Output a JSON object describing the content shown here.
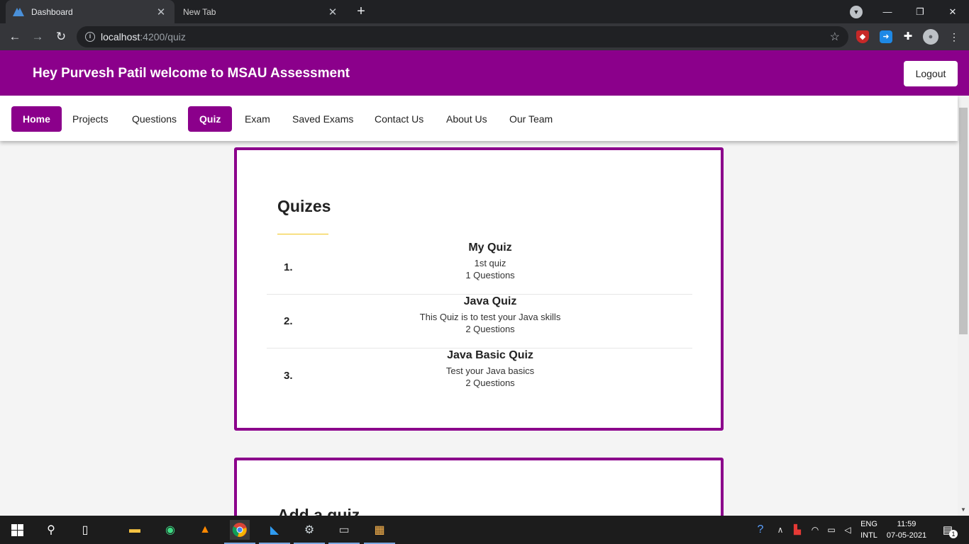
{
  "browser": {
    "tabs": [
      {
        "title": "Dashboard",
        "active": true
      },
      {
        "title": "New Tab",
        "active": false
      }
    ],
    "new_tab_glyph": "+",
    "url_host": "localhost",
    "url_path": ":4200/quiz"
  },
  "app": {
    "header_title": "Hey Purvesh Patil welcome to MSAU Assessment",
    "logout_label": "Logout",
    "accent_color": "#8b008b",
    "nav": [
      {
        "label": "Home",
        "active": true
      },
      {
        "label": "Projects",
        "active": false
      },
      {
        "label": "Questions",
        "active": false
      },
      {
        "label": "Quiz",
        "active": true
      },
      {
        "label": "Exam",
        "active": false
      },
      {
        "label": "Saved Exams",
        "active": false
      },
      {
        "label": "Contact Us",
        "active": false
      },
      {
        "label": "About Us",
        "active": false
      },
      {
        "label": "Our Team",
        "active": false
      }
    ]
  },
  "quizzes": {
    "title": "Quizes",
    "items": [
      {
        "number": "1.",
        "name": "My Quiz",
        "description": "1st quiz",
        "count": "1 Questions"
      },
      {
        "number": "2.",
        "name": "Java Quiz",
        "description": "This Quiz is to test your Java skills",
        "count": "2 Questions"
      },
      {
        "number": "3.",
        "name": "Java Basic Quiz",
        "description": "Test your Java basics",
        "count": "2 Questions"
      }
    ]
  },
  "add_quiz": {
    "title": "Add a quiz"
  },
  "taskbar": {
    "lang_line1": "ENG",
    "lang_line2": "INTL",
    "time": "11:59",
    "date": "07-05-2021",
    "notification_count": "1"
  }
}
